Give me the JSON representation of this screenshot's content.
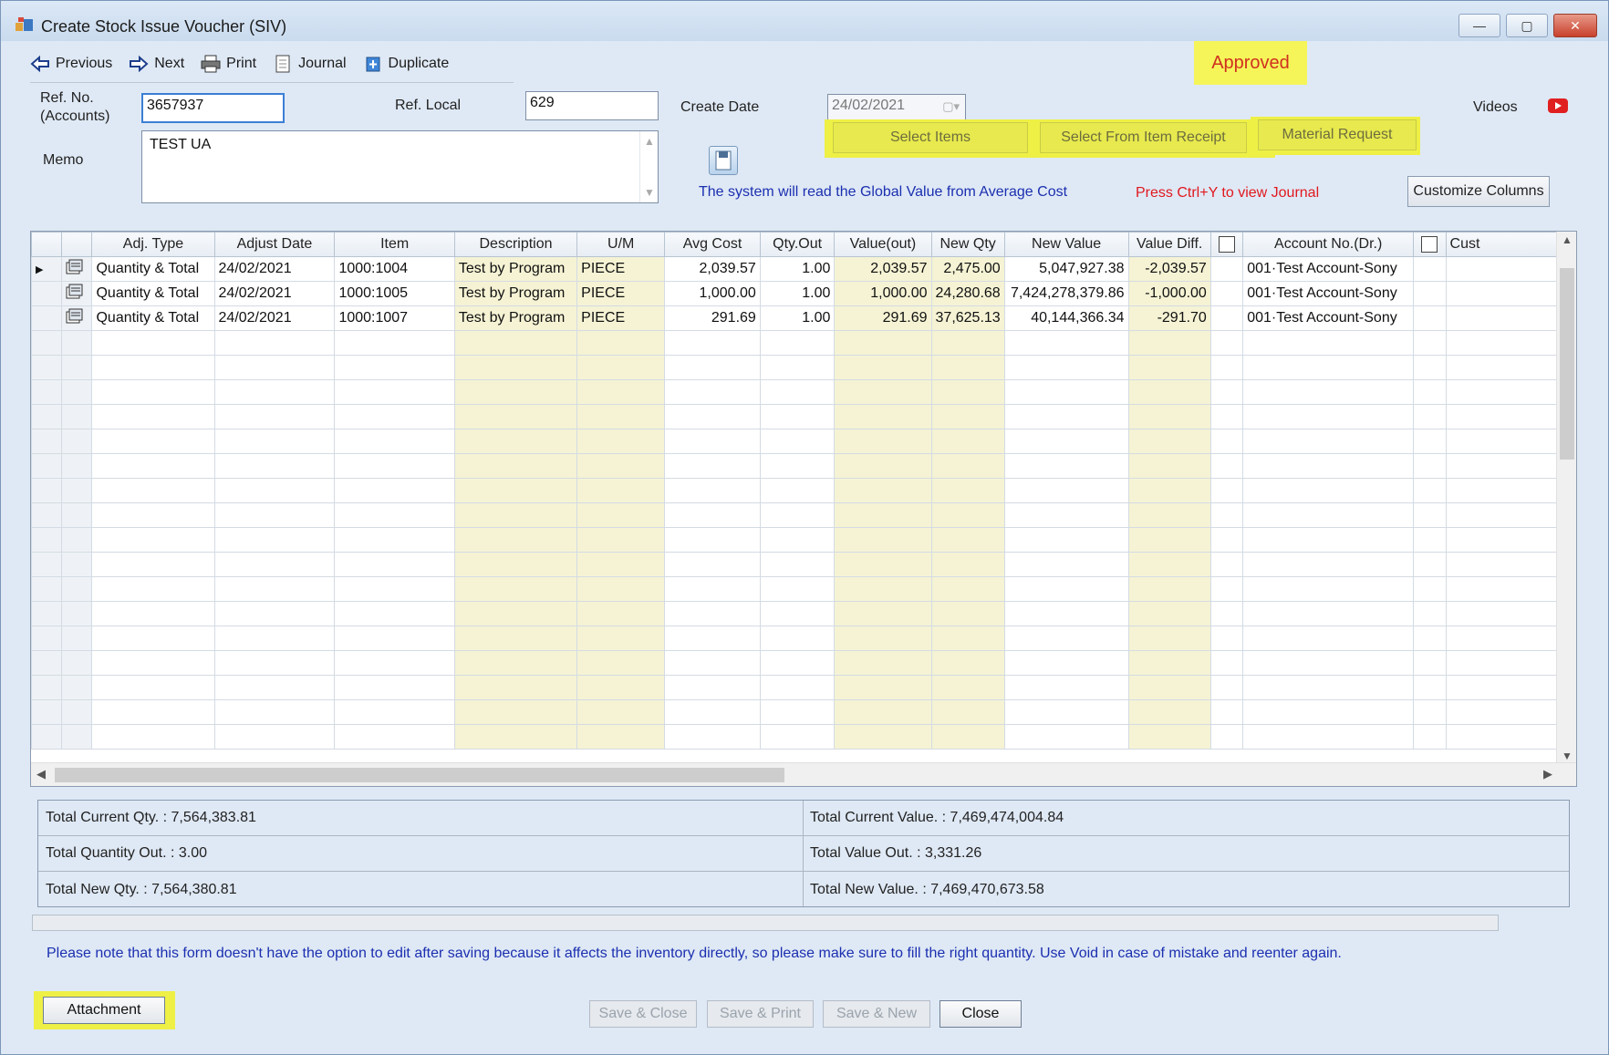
{
  "window": {
    "title": "Create Stock Issue Voucher (SIV)",
    "minimize_glyph": "—",
    "maximize_glyph": "▢",
    "close_glyph": "✕"
  },
  "toolbar": {
    "previous_label": "Previous",
    "next_label": "Next",
    "print_label": "Print",
    "journal_label": "Journal",
    "duplicate_label": "Duplicate"
  },
  "status": {
    "approved_label": "Approved"
  },
  "form": {
    "ref_no_label_line1": "Ref. No.",
    "ref_no_label_line2": "(Accounts)",
    "ref_no_value": "3657937",
    "ref_local_label": "Ref. Local",
    "ref_local_value": "629",
    "create_date_label": "Create Date",
    "create_date_value": "24/02/2021",
    "memo_label": "Memo",
    "memo_value": "TEST UA",
    "videos_label": "Videos"
  },
  "actions": {
    "select_items_label": "Select Items",
    "select_from_receipt_label": "Select From Item Receipt",
    "material_request_label": "Material Request",
    "customize_columns_label": "Customize Columns"
  },
  "info": {
    "global_value_note": "The system will read the Global Value from Average Cost",
    "journal_hint": "Press Ctrl+Y to view Journal"
  },
  "grid": {
    "columns": [
      "Adj. Type",
      "Adjust Date",
      "Item",
      "Description",
      "U/M",
      "Avg Cost",
      "Qty.Out",
      "Value(out)",
      "New Qty",
      "New Value",
      "Value Diff.",
      "Account No.(Dr.)",
      "Cust"
    ],
    "rows": [
      [
        "Quantity & Total",
        "24/02/2021",
        "1000:1004",
        "Test by Program",
        "PIECE",
        "2,039.57",
        "1.00",
        "2,039.57",
        "2,475.00",
        "5,047,927.38",
        "-2,039.57",
        "001·Test Account-Sony",
        ""
      ],
      [
        "Quantity & Total",
        "24/02/2021",
        "1000:1005",
        "Test by Program",
        "PIECE",
        "1,000.00",
        "1.00",
        "1,000.00",
        "24,280.68",
        "7,424,278,379.86",
        "-1,000.00",
        "001·Test Account-Sony",
        ""
      ],
      [
        "Quantity & Total",
        "24/02/2021",
        "1000:1007",
        "Test by Program",
        "PIECE",
        "291.69",
        "1.00",
        "291.69",
        "37,625.13",
        "40,144,366.34",
        "-291.70",
        "001·Test Account-Sony",
        ""
      ]
    ]
  },
  "totals": {
    "current_qty": "Total Current Qty. : 7,564,383.81",
    "current_value": "Total Current Value. : 7,469,474,004.84",
    "quantity_out": "Total Quantity Out. : 3.00",
    "value_out": "Total Value Out. : 3,331.26",
    "new_qty": "Total New Qty. : 7,564,380.81",
    "new_value": "Total New Value. : 7,469,470,673.58"
  },
  "note": "Please note that this form doesn't have the option to edit after saving because it affects the inventory directly, so please make sure to fill the right quantity. Use Void in case of mistake and reenter again.",
  "buttons": {
    "attachment_label": "Attachment",
    "save_close_label": "Save & Close",
    "save_print_label": "Save & Print",
    "save_new_label": "Save & New",
    "close_label": "Close"
  },
  "colors": {
    "highlight_yellow": "#eef046",
    "approved_text": "#d0301f",
    "info_blue": "#1b2fb0",
    "info_red": "#e0181f",
    "grid_yellow": "#f5f3d4"
  }
}
